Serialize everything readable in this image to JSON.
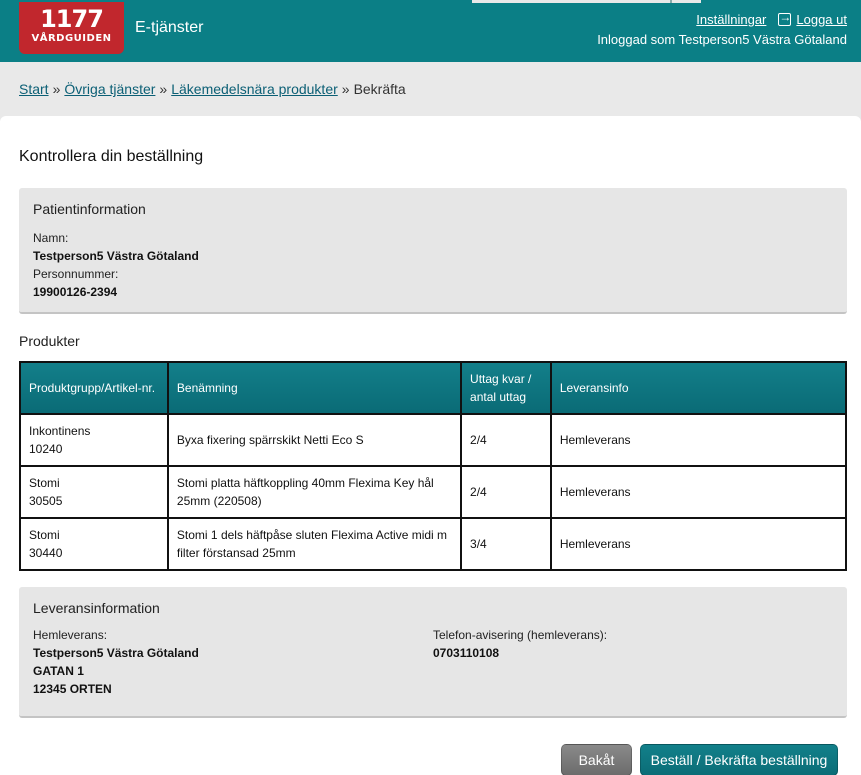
{
  "header": {
    "logo_number": "1177",
    "logo_text": "VÅRDGUIDEN",
    "app_title": "E-tjänster",
    "settings_link": "Inställningar",
    "logout_link": "Logga ut",
    "logged_in_as": "Inloggad som Testperson5 Västra Götaland"
  },
  "breadcrumb": {
    "items": [
      "Start",
      "Övriga tjänster",
      "Läkemedelsnära produkter"
    ],
    "separator": "»",
    "current": "Bekräfta"
  },
  "page": {
    "title": "Kontrollera din beställning"
  },
  "patient": {
    "title": "Patientinformation",
    "name_label": "Namn:",
    "name_value": "Testperson5 Västra Götaland",
    "pnr_label": "Personnummer:",
    "pnr_value": "19900126-2394"
  },
  "products": {
    "heading": "Produkter",
    "columns": {
      "group": "Produktgrupp/Artikel-nr.",
      "name": "Benämning",
      "uttag_line1": "Uttag kvar /",
      "uttag_line2": "antal uttag",
      "delivery": "Leveransinfo"
    },
    "rows": [
      {
        "group": "Inkontinens",
        "article": "10240",
        "name": "Byxa fixering spärrskikt Netti Eco S",
        "uttag": "2/4",
        "delivery": "Hemleverans"
      },
      {
        "group": "Stomi",
        "article": "30505",
        "name": "Stomi platta häftkoppling 40mm Flexima Key hål 25mm (220508)",
        "uttag": "2/4",
        "delivery": "Hemleverans"
      },
      {
        "group": "Stomi",
        "article": "30440",
        "name": "Stomi 1 dels häftpåse sluten Flexima Active midi m filter förstansad 25mm",
        "uttag": "3/4",
        "delivery": "Hemleverans"
      }
    ]
  },
  "delivery": {
    "title": "Leveransinformation",
    "home_label": "Hemleverans:",
    "home_name": "Testperson5 Västra Götaland",
    "home_street": "GATAN 1",
    "home_city": "12345 ORTEN",
    "phone_label": "Telefon-avisering (hemleverans):",
    "phone_value": "0703110108"
  },
  "buttons": {
    "back": "Bakåt",
    "confirm": "Beställ / Bekräfta beställning"
  },
  "colors": {
    "brand_teal": "#0b7f86",
    "logo_red": "#c1272d",
    "link": "#0b5f75"
  }
}
